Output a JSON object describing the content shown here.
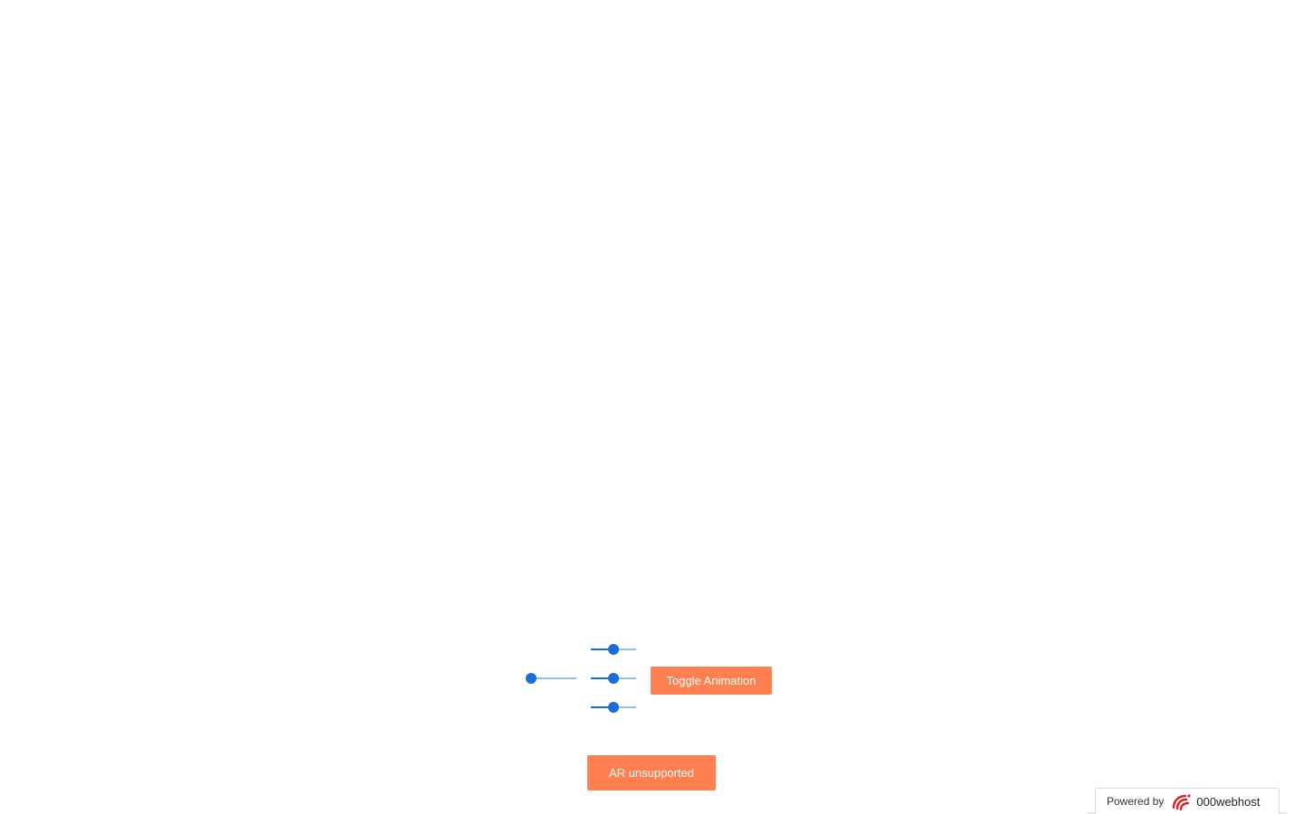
{
  "viewer": {
    "label": ""
  },
  "controls": {
    "sliders": [
      {
        "name": "slider-left",
        "value": 0.0
      },
      {
        "name": "slider-top",
        "value": 0.5
      },
      {
        "name": "slider-middle",
        "value": 0.5
      },
      {
        "name": "slider-bottom",
        "value": 0.5
      }
    ],
    "toggle_animation_label": "Toggle Animation",
    "ar_button_label": "AR unsupported"
  },
  "badge": {
    "powered_by": "Powered by",
    "brand": "000webhost",
    "logo_icon": "000webhost-logo-icon",
    "logo_color": "#e02020"
  },
  "colors": {
    "accent_button": "#ff7f50",
    "slider_active": "#1a6fd6",
    "slider_track": "#90c0ec"
  }
}
